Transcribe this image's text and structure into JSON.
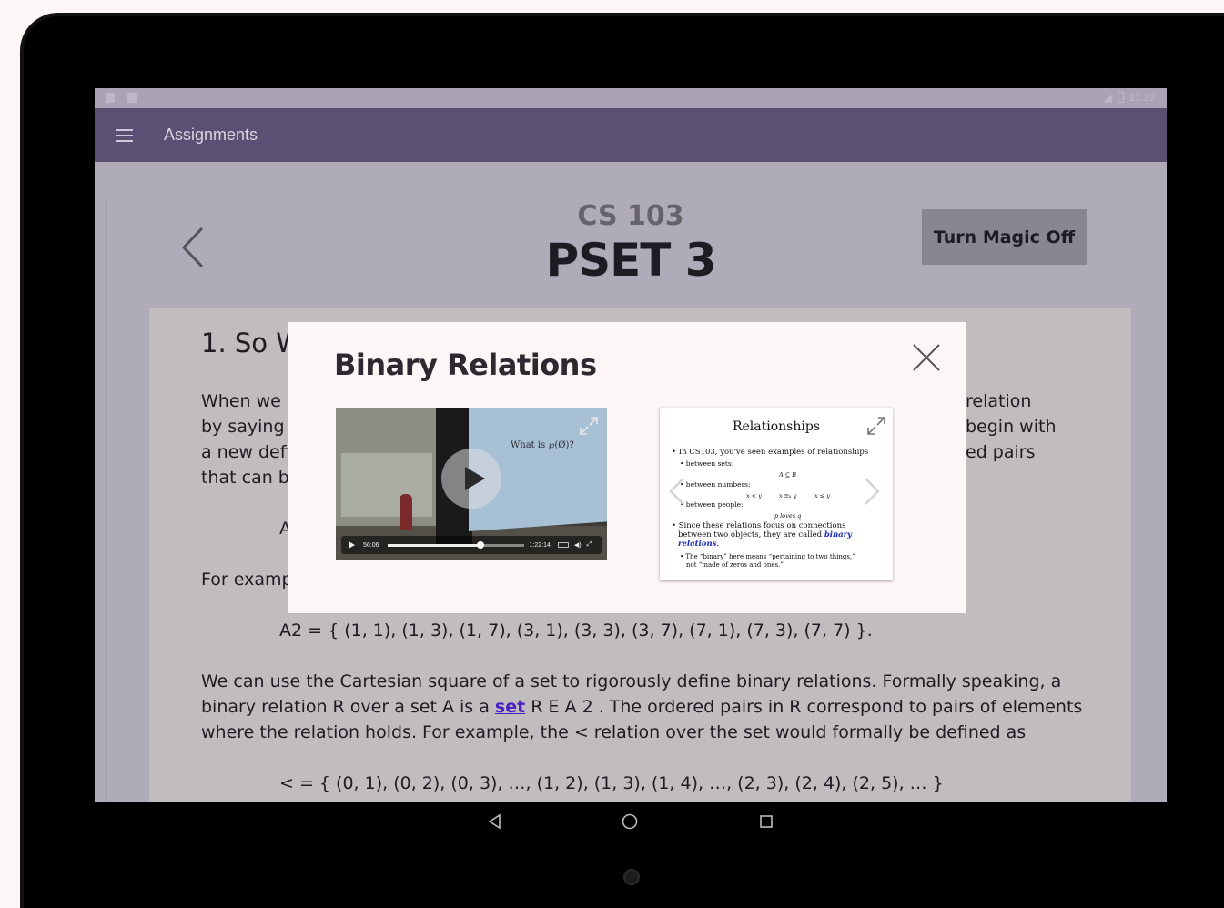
{
  "appbar": {
    "title": "Assignments"
  },
  "statusbar": {
    "time": "11:22"
  },
  "header": {
    "course": "CS 103",
    "assignment": "PSET 3",
    "magic_button": "Turn Magic Off"
  },
  "card": {
    "heading": "1. So W",
    "para1": [
      {
        "left": "When we c",
        "right": "relation"
      },
      {
        "left": "by saying w",
        "right": "begin with"
      },
      {
        "left": "a new defi",
        "right": "ed pairs"
      },
      {
        "left": "that can be",
        "right": ""
      }
    ],
    "set_a_prefix": "A",
    "example_prefix": "For examp",
    "a2_formula": "A2 = { (1, 1), (1, 3), (1, 7), (3, 1), (3, 3), (3, 7), (7, 1), (7, 3), (7, 7) }.",
    "para2_line1": "We can use the Cartesian square of a set to rigorously define binary relations. Formally speaking, a",
    "para2_line2_before": "binary relation R over a set A is a ",
    "para2_link": "set",
    "para2_line2_after": " R E A 2 . The ordered pairs in R correspond to pairs of elements",
    "para2_line3": "where the relation holds. For example, the < relation over the set would formally be defined as",
    "lt_formula": "< = { (0, 1), (0, 2), (0, 3), …, (1, 2), (1, 3), (1, 4), …, (2, 3), (2, 4), (2, 5), … }"
  },
  "modal": {
    "title": "Binary Relations",
    "video": {
      "slide_text": "What is ℘(Ø)?",
      "current_time": "56:06",
      "duration": "1:22:14",
      "progress": 0.68
    },
    "slide": {
      "title": "Relationships",
      "b1": "• In CS103, you've seen examples of relationships",
      "b1a": "• between sets:",
      "b1a_ex": "A ⊆ B",
      "b1b": "• between numbers:",
      "b1b_ex1": "x < y",
      "b1b_ex2": "x ≡ₖ y",
      "b1b_ex3": "x ≤ y",
      "b1c": "• between people:",
      "b1c_ex": "p loves q",
      "b2_l1": "• Since these relations focus on connections",
      "b2_l2": "between two objects, they are called",
      "b2_em1": "binary",
      "b2_em2": "relations",
      "b3_l1": "• The “binary” here means “pertaining to two things,”",
      "b3_l2": "not “made of zeros and ones.”"
    }
  },
  "colors": {
    "appbar": "#5b4f73",
    "overlay_bg": "#b0abb9",
    "card_bg": "#c1bdbf",
    "modal_bg": "#fdf6f6",
    "link": "#4b1fc4",
    "button_bg": "#898690"
  },
  "icons": [
    "menu-icon",
    "back-chevron-icon",
    "close-icon",
    "expand-icon",
    "play-icon",
    "chevron-left-icon",
    "chevron-right-icon",
    "nav-back-icon",
    "nav-home-icon",
    "nav-recents-icon"
  ]
}
